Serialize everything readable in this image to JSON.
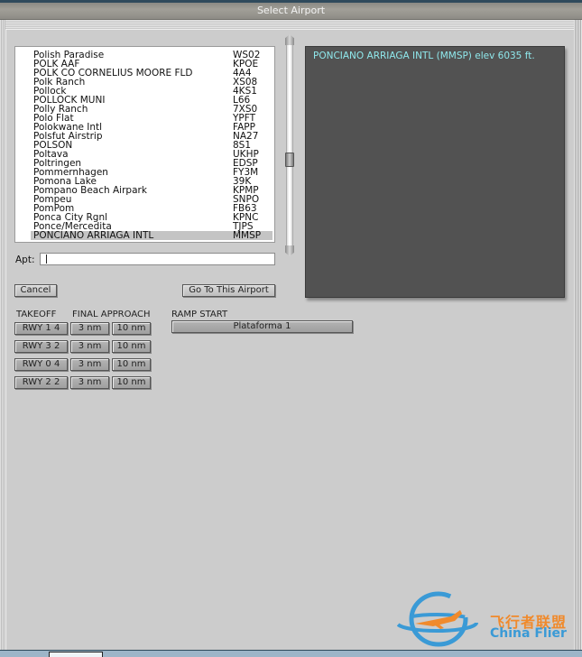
{
  "window": {
    "title": "Select Airport"
  },
  "airport_list": {
    "selected_index": 20,
    "items": [
      {
        "name": "Polish Paradise",
        "code": "WS02"
      },
      {
        "name": "POLK AAF",
        "code": "KPOE"
      },
      {
        "name": "POLK CO CORNELIUS MOORE FLD",
        "code": "4A4"
      },
      {
        "name": "Polk Ranch",
        "code": "XS08"
      },
      {
        "name": "Pollock",
        "code": "4KS1"
      },
      {
        "name": "POLLOCK MUNI",
        "code": "L66"
      },
      {
        "name": "Polly Ranch",
        "code": "7XS0"
      },
      {
        "name": "Polo Flat",
        "code": "YPFT"
      },
      {
        "name": "Polokwane Intl",
        "code": "FAPP"
      },
      {
        "name": "Polsfut Airstrip",
        "code": "NA27"
      },
      {
        "name": "POLSON",
        "code": "8S1"
      },
      {
        "name": "Poltava",
        "code": "UKHP"
      },
      {
        "name": "Poltringen",
        "code": "EDSP"
      },
      {
        "name": "Pommernhagen",
        "code": "FY3M"
      },
      {
        "name": "Pomona Lake",
        "code": "39K"
      },
      {
        "name": "Pompano Beach Airpark",
        "code": "KPMP"
      },
      {
        "name": "Pompeu",
        "code": "SNPO"
      },
      {
        "name": "PomPom",
        "code": "FB63"
      },
      {
        "name": "Ponca City Rgnl",
        "code": "KPNC"
      },
      {
        "name": "Ponce/Mercedita",
        "code": "TJPS"
      },
      {
        "name": "PONCIANO ARRIAGA INTL",
        "code": "MMSP"
      }
    ]
  },
  "info_panel": {
    "text": "PONCIANO ARRIAGA INTL (MMSP) elev 6035 ft."
  },
  "apt_field": {
    "label": "Apt:",
    "value": ""
  },
  "buttons": {
    "cancel": "Cancel",
    "go": "Go To This Airport"
  },
  "sections": {
    "takeoff": "TAKEOFF",
    "final_approach": "FINAL APPROACH",
    "ramp_start": "RAMP START"
  },
  "runways": [
    {
      "takeoff": "RWY 1 4",
      "near": "3 nm",
      "far": "10 nm"
    },
    {
      "takeoff": "RWY 3 2",
      "near": "3 nm",
      "far": "10 nm"
    },
    {
      "takeoff": "RWY 0 4",
      "near": "3 nm",
      "far": "10 nm"
    },
    {
      "takeoff": "RWY 2 2",
      "near": "3 nm",
      "far": "10 nm"
    }
  ],
  "ramp_starts": [
    {
      "label": "Plataforma 1"
    }
  ],
  "watermark": {
    "cn": "飞行者联盟",
    "en": "China Flier",
    "blue": "#3a9ad6",
    "orange": "#f08a2c"
  },
  "colors": {
    "info_text": "#8fe8ec",
    "info_bg": "#525252",
    "selection": "#c4c4c4"
  }
}
